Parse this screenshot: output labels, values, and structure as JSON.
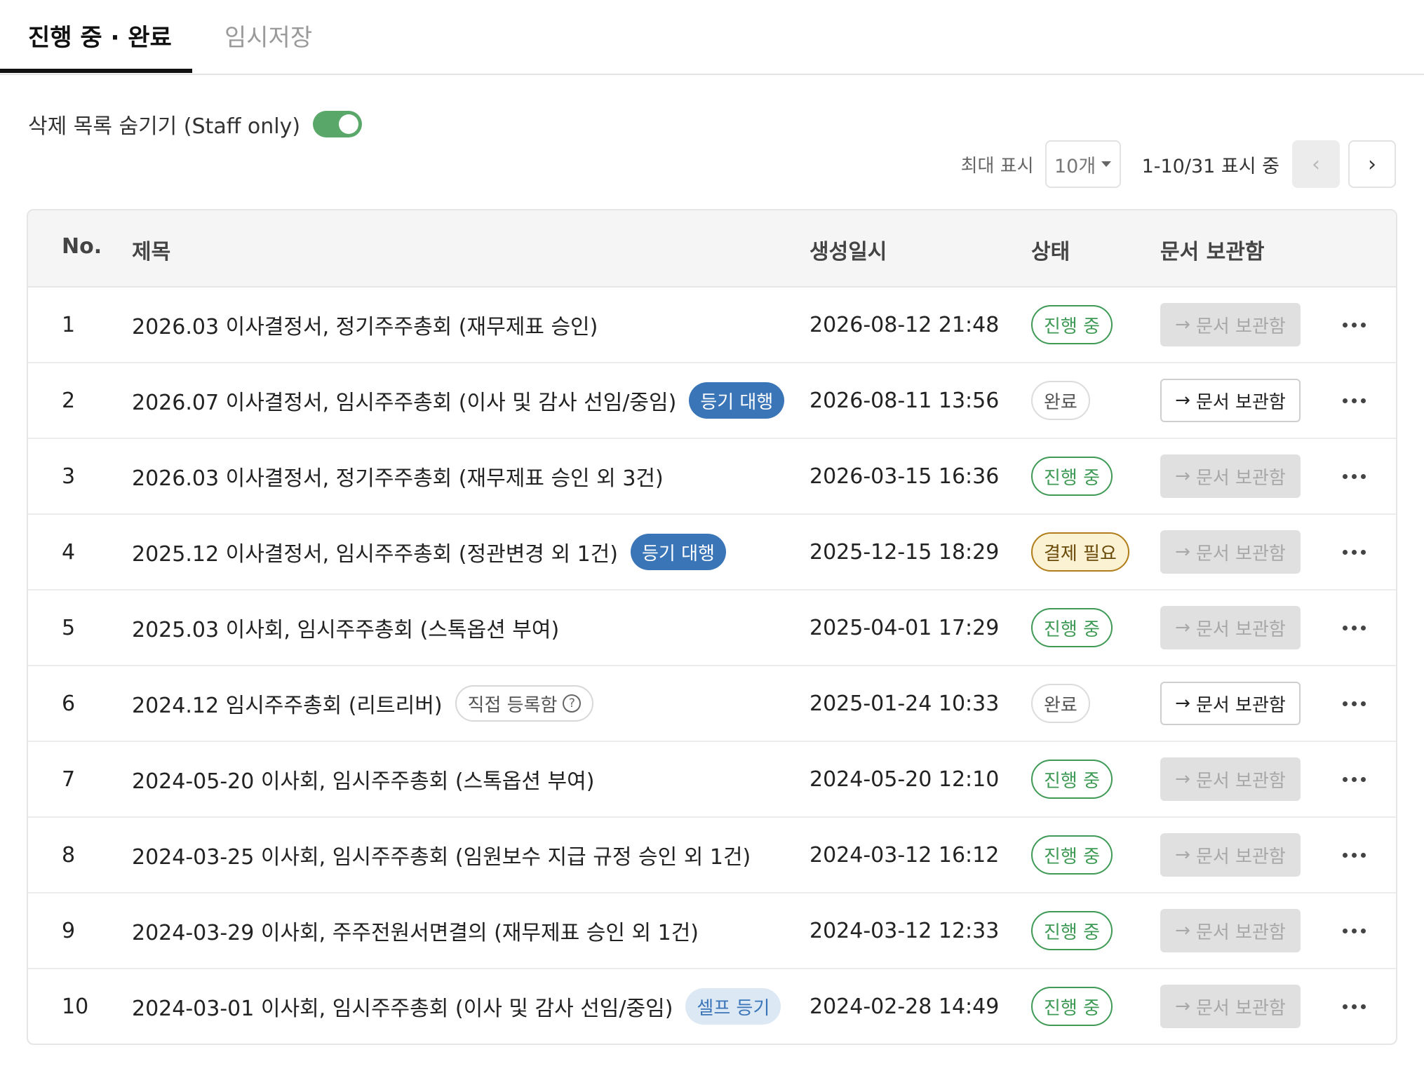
{
  "tabs": [
    {
      "label": "진행 중 · 완료",
      "active": true
    },
    {
      "label": "임시저장",
      "active": false
    }
  ],
  "toggle": {
    "label": "삭제 목록 숨기기 (Staff only)",
    "on": true,
    "color": "#59a86a"
  },
  "pagination": {
    "label": "최대 표시",
    "page_size": "10개",
    "range_text": "1-10/31 표시 중",
    "prev_icon": "‹",
    "next_icon": "›"
  },
  "table": {
    "headers": {
      "no": "No.",
      "title": "제목",
      "created": "생성일시",
      "status": "상태",
      "vault": "문서 보관함"
    },
    "rows": [
      {
        "no": "1",
        "title": "2026.03 이사결정서, 정기주주총회 (재무제표 승인)",
        "tag": null,
        "created": "2026-08-12 21:48",
        "status": "진행 중",
        "status_type": "progress",
        "vault": "문서 보관함",
        "vault_enabled": false
      },
      {
        "no": "2",
        "title": "2026.07 이사결정서, 임시주주총회 (이사 및 감사 선임/중임)",
        "tag": {
          "text": "등기 대행",
          "style": "solid"
        },
        "created": "2026-08-11 13:56",
        "status": "완료",
        "status_type": "done",
        "vault": "문서 보관함",
        "vault_enabled": true
      },
      {
        "no": "3",
        "title": "2026.03 이사결정서, 정기주주총회 (재무제표 승인 외 3건)",
        "tag": null,
        "created": "2026-03-15 16:36",
        "status": "진행 중",
        "status_type": "progress",
        "vault": "문서 보관함",
        "vault_enabled": false
      },
      {
        "no": "4",
        "title": "2025.12 이사결정서, 임시주주총회 (정관변경 외 1건)",
        "tag": {
          "text": "등기 대행",
          "style": "solid"
        },
        "created": "2025-12-15 18:29",
        "status": "결제 필요",
        "status_type": "pay",
        "vault": "문서 보관함",
        "vault_enabled": false
      },
      {
        "no": "5",
        "title": "2025.03 이사회, 임시주주총회 (스톡옵션 부여)",
        "tag": null,
        "created": "2025-04-01 17:29",
        "status": "진행 중",
        "status_type": "progress",
        "vault": "문서 보관함",
        "vault_enabled": false
      },
      {
        "no": "6",
        "title": "2024.12 임시주주총회 (리트리버)",
        "tag": {
          "text": "직접 등록함",
          "style": "outline",
          "help_icon": "?"
        },
        "created": "2025-01-24 10:33",
        "status": "완료",
        "status_type": "done",
        "vault": "문서 보관함",
        "vault_enabled": true
      },
      {
        "no": "7",
        "title": "2024-05-20 이사회, 임시주주총회 (스톡옵션 부여)",
        "tag": null,
        "created": "2024-05-20 12:10",
        "status": "진행 중",
        "status_type": "progress",
        "vault": "문서 보관함",
        "vault_enabled": false
      },
      {
        "no": "8",
        "title": "2024-03-25 이사회, 임시주주총회 (임원보수 지급 규정 승인 외 1건)",
        "tag": null,
        "created": "2024-03-12 16:12",
        "status": "진행 중",
        "status_type": "progress",
        "vault": "문서 보관함",
        "vault_enabled": false
      },
      {
        "no": "9",
        "title": "2024-03-29 이사회, 주주전원서면결의 (재무제표 승인 외 1건)",
        "tag": null,
        "created": "2024-03-12 12:33",
        "status": "진행 중",
        "status_type": "progress",
        "vault": "문서 보관함",
        "vault_enabled": false
      },
      {
        "no": "10",
        "title": "2024-03-01 이사회, 임시주주총회 (이사 및 감사 선임/중임)",
        "tag": {
          "text": "셀프 등기",
          "style": "soft"
        },
        "created": "2024-02-28 14:49",
        "status": "진행 중",
        "status_type": "progress",
        "vault": "문서 보관함",
        "vault_enabled": false
      }
    ]
  },
  "icons": {
    "vault_arrow": "→",
    "more": "more-horizontal-icon"
  },
  "colors": {
    "progress": "#3f9a56",
    "tag_solid": "#3a75b8",
    "pay_bg": "#fbf1d3"
  }
}
